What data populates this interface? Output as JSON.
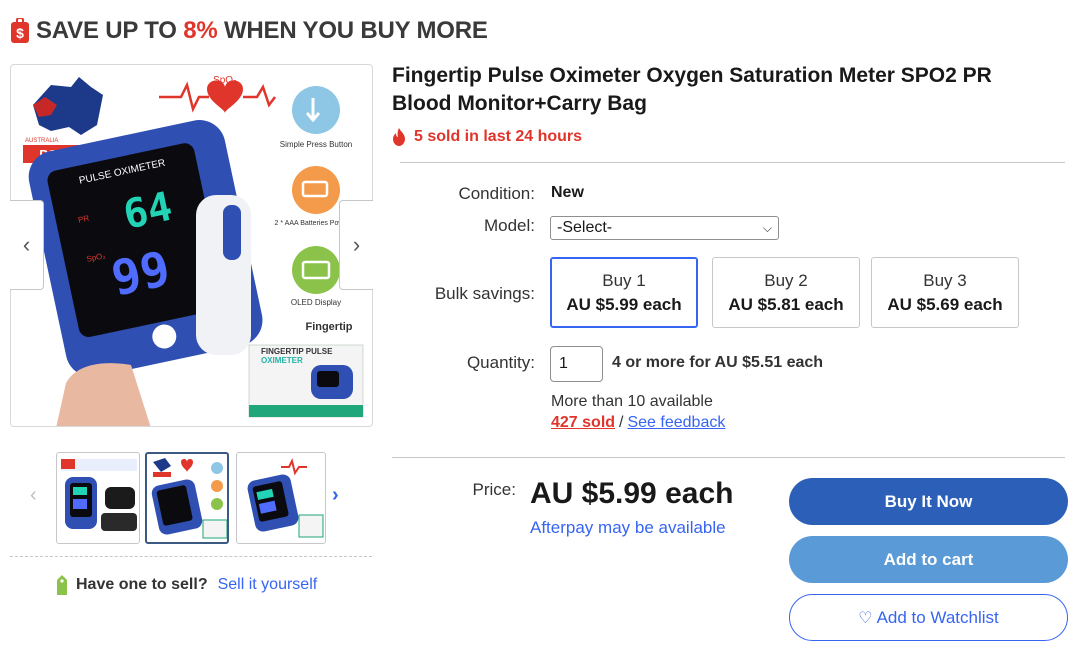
{
  "banner": {
    "prefix": "SAVE UP TO",
    "percent": "8%",
    "suffix": "WHEN YOU BUY MORE",
    "icon": "price-tag-icon",
    "accent_color": "#e0352b"
  },
  "gallery": {
    "image_labels": {
      "post_brand": "POST",
      "australia": "AUSTRALIA",
      "device_label": "PULSE OXIMETER",
      "spo2_label": "SpO₂",
      "pr_label": "PR",
      "spo2_reading": "99",
      "pr_reading": "64",
      "heart_label": "SpO₂",
      "feature_1": "Simple Press Button",
      "feature_2": "2 * AAA Batteries Powered",
      "feature_3": "OLED Display",
      "brand_mark": "Fingertip",
      "box_line1": "FINGERTIP PULSE",
      "box_line2": "OXIMETER"
    },
    "prev_arrow": "‹",
    "next_arrow": "›",
    "thumb_prev": "‹",
    "thumb_next": "›",
    "selected_thumb": 2
  },
  "sell": {
    "question": "Have one to sell?",
    "link": "Sell it yourself"
  },
  "listing": {
    "title": "Fingertip Pulse Oximeter Oxygen Saturation Meter SPO2 PR Blood Monitor+Carry Bag",
    "sold_24h": "5 sold in last 24 hours",
    "condition_label": "Condition:",
    "condition_value": "New",
    "model_label": "Model:",
    "model_selected": "-Select-",
    "bulk_label": "Bulk savings:",
    "bulk_options": [
      {
        "qty": "Buy 1",
        "price": "AU $5.99 each"
      },
      {
        "qty": "Buy 2",
        "price": "AU $5.81 each"
      },
      {
        "qty": "Buy 3",
        "price": "AU $5.69 each"
      }
    ],
    "quantity_label": "Quantity:",
    "quantity_value": "1",
    "quantity_offer": "4 or more for AU $5.51 each",
    "availability": "More than 10 available",
    "sold_total": "427 sold",
    "separator": "/",
    "feedback_link": "See feedback",
    "price_label": "Price:",
    "price": "AU $5.99 each",
    "afterpay": "Afterpay may be available"
  },
  "actions": {
    "buy_now": "Buy It Now",
    "add_to_cart": "Add to cart",
    "watchlist": "Add to Watchlist",
    "watch_icon": "heart-icon"
  },
  "colors": {
    "link_blue": "#3665f3",
    "buy_button": "#2c5fb8",
    "cart_button": "#5a9ad6",
    "alert_red": "#e0352b"
  }
}
